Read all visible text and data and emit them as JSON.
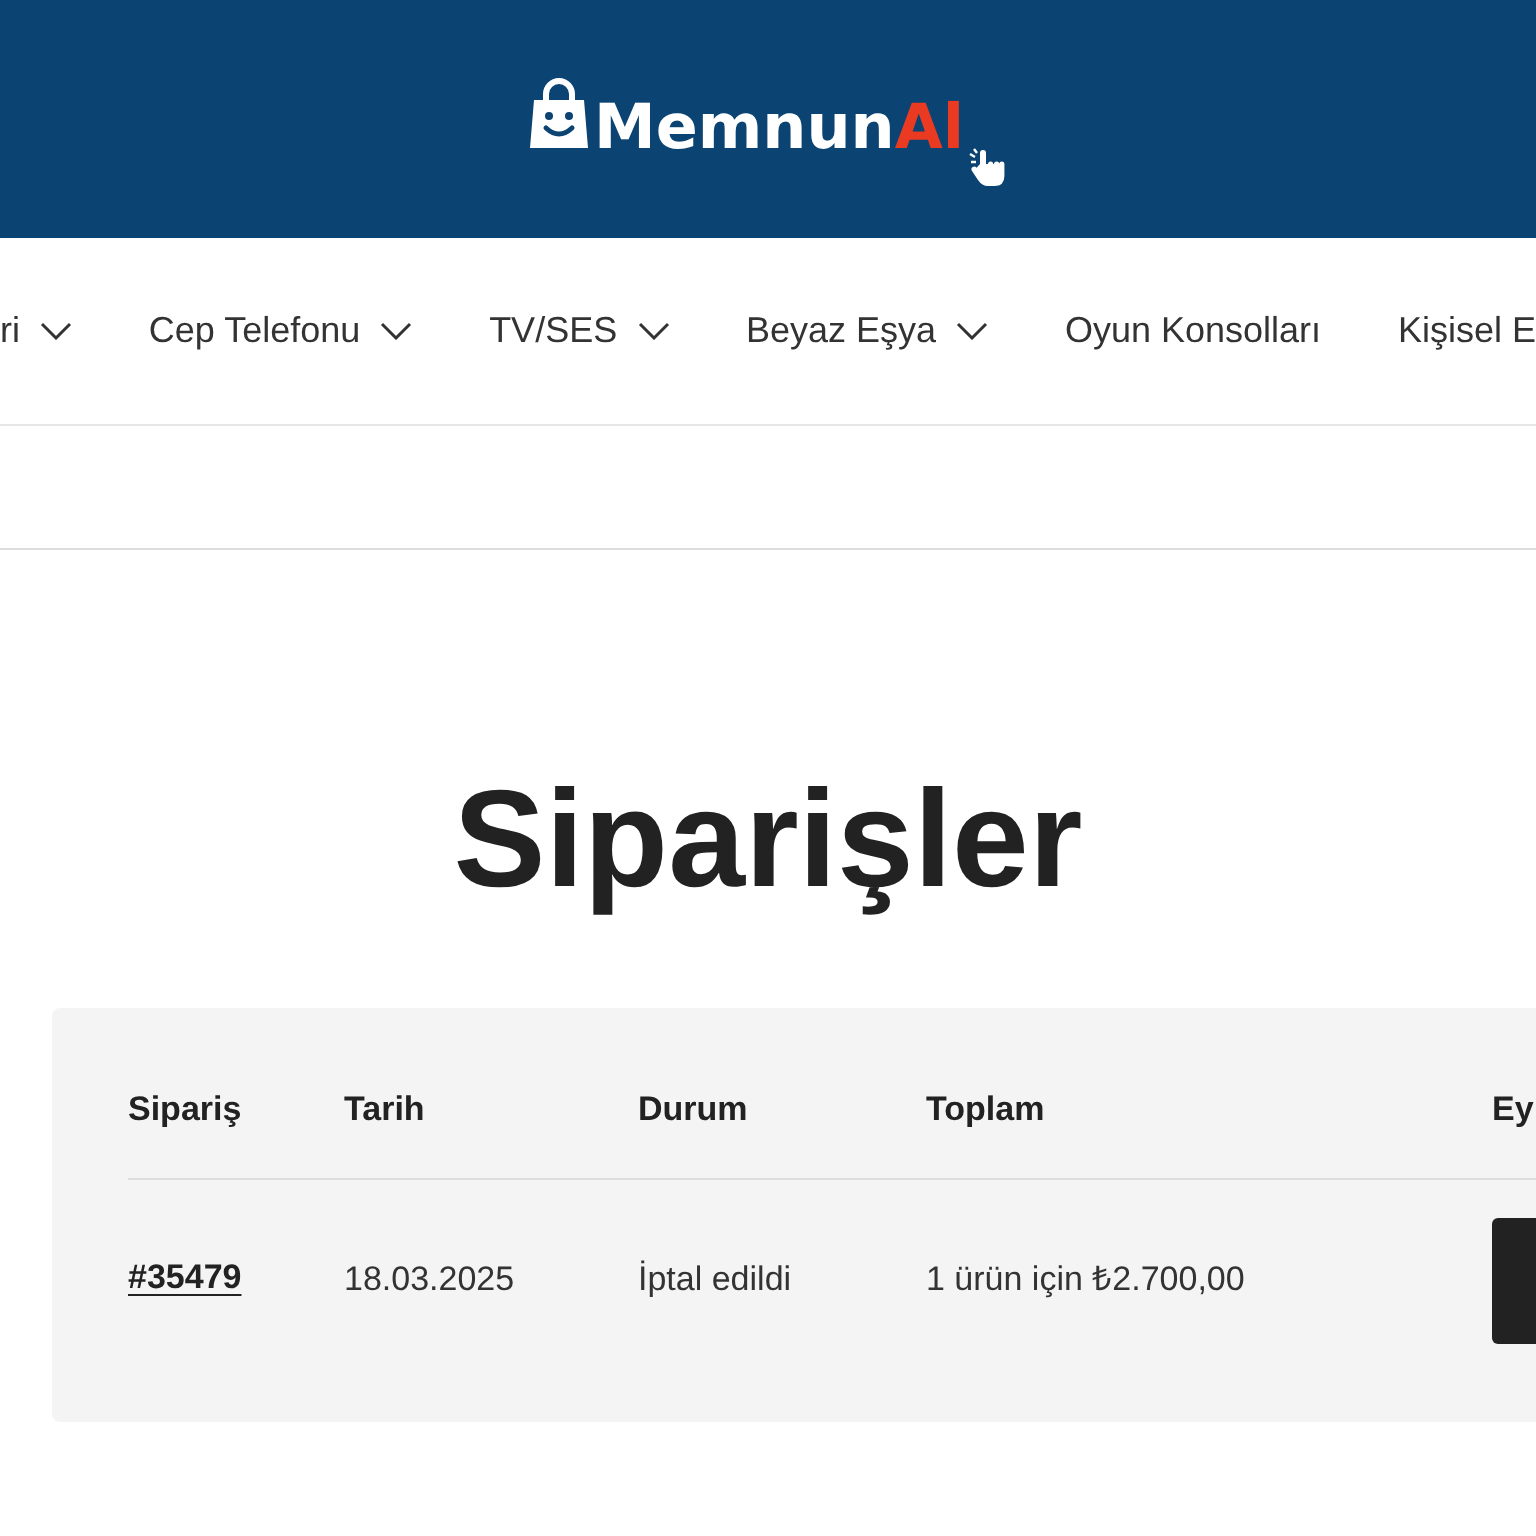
{
  "header": {
    "logo": {
      "text": "Memnun",
      "accent": "Al"
    }
  },
  "nav": {
    "items": [
      {
        "label": "ri",
        "has_menu": true
      },
      {
        "label": "Cep Telefonu",
        "has_menu": true
      },
      {
        "label": "TV/SES",
        "has_menu": true
      },
      {
        "label": "Beyaz Eşya",
        "has_menu": true
      },
      {
        "label": "Oyun Konsolları",
        "has_menu": false
      },
      {
        "label": "Kişisel E",
        "has_menu": false
      }
    ]
  },
  "page_title": "Siparişler",
  "orders_table": {
    "columns": [
      "Sipariş",
      "Tarih",
      "Durum",
      "Toplam",
      "Ey"
    ],
    "rows": [
      {
        "order": "#35479",
        "date": "18.03.2025",
        "status": "İptal edildi",
        "total": "1 ürün için ₺2.700,00"
      }
    ]
  }
}
